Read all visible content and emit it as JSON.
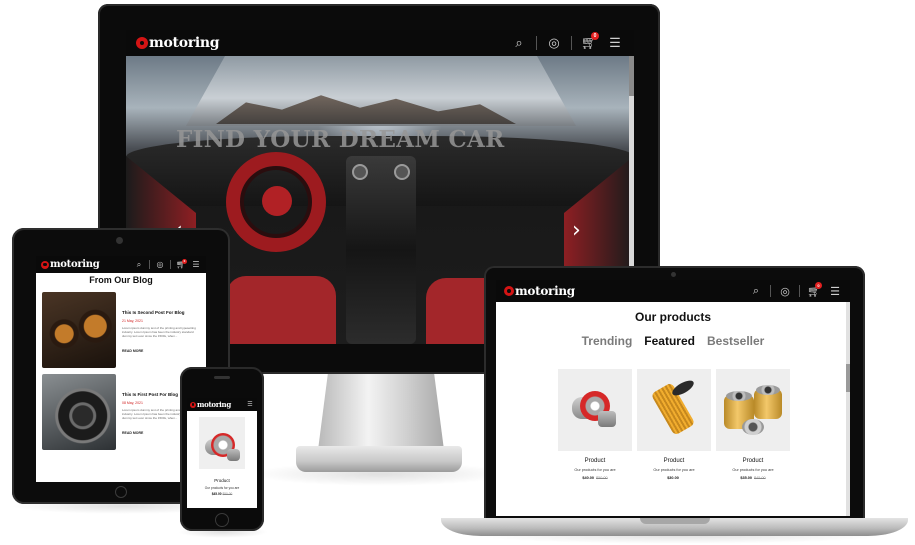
{
  "brand": {
    "name": "motoring",
    "accent_color": "#d41414",
    "navbar_color": "#0a0a0a"
  },
  "nav_icons": [
    "search-icon",
    "user-icon",
    "cart-icon",
    "menu-icon"
  ],
  "cart": {
    "count": "0"
  },
  "monitor": {
    "hero_title": "FIND YOUR DREAM CAR",
    "prev_arrow": "‹",
    "next_arrow": "›"
  },
  "tablet": {
    "section_title": "From Our Blog",
    "posts": [
      {
        "title": "This Is Second Post For Blog",
        "date": "21 May, 2021",
        "excerpt": "Lorem ipsum dummy text of the printing and typesetting industry. Lorem Ipsum has been the industry standard dummy text ever since the 1500s, when...",
        "more": "READ MORE"
      },
      {
        "title": "This Is First Post For Blog",
        "date": "08 May, 2021",
        "excerpt": "Lorem ipsum dummy text of the printing and typesetting industry. Lorem Ipsum has been the industry standard dummy text ever since the 1500s, when...",
        "more": "READ MORE"
      }
    ]
  },
  "laptop": {
    "section_title": "Our products",
    "tabs": [
      {
        "label": "Trending",
        "active": false
      },
      {
        "label": "Featured",
        "active": true
      },
      {
        "label": "Bestseller",
        "active": false
      }
    ],
    "products": [
      {
        "name": "Product",
        "desc": "Our products for you are",
        "price": "$40.00",
        "old_price": "$50.00",
        "icon": "turbocharger"
      },
      {
        "name": "Product",
        "desc": "Our products for you are",
        "price": "$30.00",
        "old_price": "",
        "icon": "oil-filter"
      },
      {
        "name": "Product",
        "desc": "Our products for you are",
        "price": "$35.00",
        "old_price": "$45.00",
        "icon": "oil-filters"
      }
    ]
  },
  "phone": {
    "product": {
      "name": "Product",
      "desc": "Our products for you are",
      "price": "$45.00",
      "old_price": "$50.00",
      "icon": "turbocharger"
    }
  }
}
